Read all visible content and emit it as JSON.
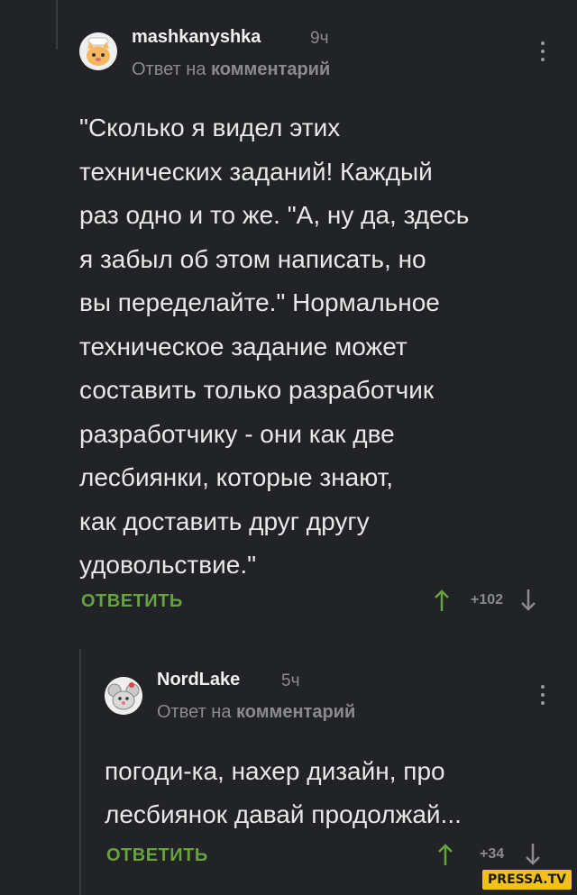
{
  "comments": [
    {
      "username": "mashkanyshka",
      "time": "9ч",
      "reply_prefix": "Ответ на",
      "reply_target": "комментарий",
      "text": "\"Сколько я видел этих\nтехнических заданий! Каждый\nраз одно и то же. \"А, ну да, здесь\nя забыл об этом написать, но\nвы переделайте.\" Нормальное\nтехническое задание может\nсоставить только разработчик\nразработчику - они как две\nлесбиянки, которые знают,\nкак доставить друг другу\nудовольствие.\"",
      "reply_label": "ОТВЕТИТЬ",
      "score": "+102"
    },
    {
      "username": "NordLake",
      "time": "5ч",
      "reply_prefix": "Ответ на",
      "reply_target": "комментарий",
      "text": "погоди-ка, нахер дизайн, про\nлесбиянок давай продолжай...",
      "reply_label": "ОТВЕТИТЬ",
      "score": "+34"
    }
  ],
  "watermark": "PRESSA.TV",
  "colors": {
    "background": "#222326",
    "accent_green": "#66a33e",
    "muted": "#8a8b8e",
    "text": "#e8e8e8"
  }
}
